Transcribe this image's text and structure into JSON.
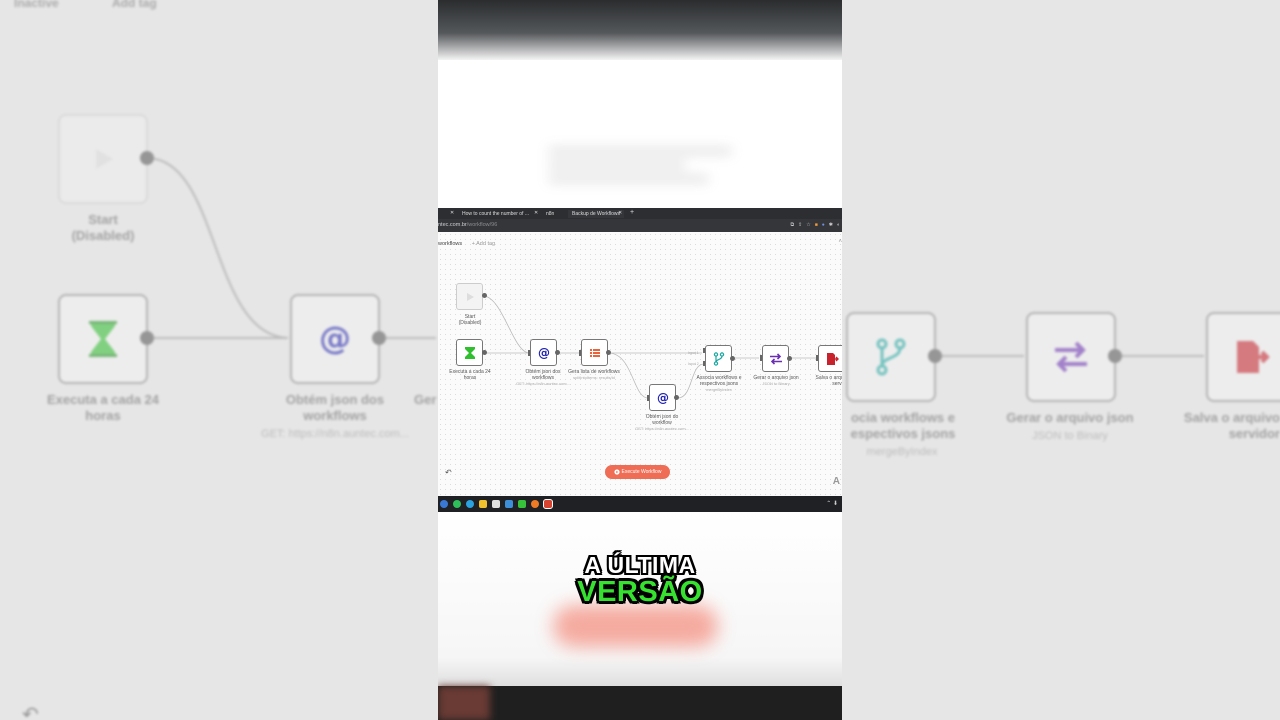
{
  "background": {
    "top_texts": [
      "Inactive",
      "Add tag"
    ],
    "nodes": [
      {
        "label": "Start\n(Disabled)",
        "icon": "play-icon"
      },
      {
        "label": "Executa a cada 24\nhoras",
        "icon": "hourglass-icon"
      },
      {
        "label": "Obtém json dos\nworkflows",
        "sub": "GET: https://n8n.auntec.com...",
        "icon": "at-icon"
      },
      {
        "label": "Ger",
        "icon": ""
      },
      {
        "label": "ocia workflows e\nespectivos jsons",
        "sub": "mergeByIndex",
        "icon": "merge-icon"
      },
      {
        "label": "Gerar o arquivo json",
        "sub": "JSON to Binary",
        "icon": "swap-icon"
      },
      {
        "label": "Salva o arquivo\nservidor",
        "icon": "file-export-icon"
      }
    ]
  },
  "browser": {
    "tabs": [
      "How to count the number of ...",
      "n8n",
      "Backup de Workflows"
    ],
    "address": {
      "host": "ntec.com.br",
      "path": "/workflow/96"
    },
    "header": {
      "title": "workflows",
      "add_tag": "+ Add tag"
    },
    "nodes": [
      {
        "id": "start",
        "label": "Start\n(Disabled)",
        "sub": "",
        "icon": "play-icon"
      },
      {
        "id": "cron",
        "label": "Executa a cada 24\nhoras",
        "sub": "",
        "icon": "hourglass-icon"
      },
      {
        "id": "get-workflows",
        "label": "Obtém json dos\nworkflows",
        "sub": "GET: https://n8n.auntec.com...",
        "icon": "at-icon"
      },
      {
        "id": "list",
        "label": "Gera lista de workflows",
        "sub": "splitIntoItems: results/id",
        "icon": "list-icon"
      },
      {
        "id": "get-workflow",
        "label": "Obtém json do\nworkflow",
        "sub": "GET: https://n8n.auntec.com...",
        "icon": "at-icon"
      },
      {
        "id": "merge",
        "label": "Associa workflows e\nrespectivos jsons",
        "sub": "mergeByIndex",
        "icon": "merge-icon"
      },
      {
        "id": "tojson",
        "label": "Gerar o arquivo json",
        "sub": "JSON to Binary",
        "icon": "swap-icon"
      },
      {
        "id": "save",
        "label": "Salva o arquivo\nservidor",
        "sub": "",
        "icon": "file-export-icon"
      }
    ],
    "merge_inputs": [
      "Input 1",
      "Input 2"
    ],
    "execute_button": "Execute Workflow",
    "corner_letter": "A"
  },
  "captions": {
    "line1": "A ÚLTIMA",
    "line2": "VERSÃO"
  },
  "colors": {
    "accent_red": "#ef6c55",
    "caption_green": "#36e22f",
    "icon_green": "#2fbf2f",
    "icon_blue": "#1f1fb0",
    "icon_orange": "#e8643c",
    "icon_teal": "#1aa7a1",
    "icon_purple": "#6b2fb3",
    "icon_red": "#c8232c"
  }
}
